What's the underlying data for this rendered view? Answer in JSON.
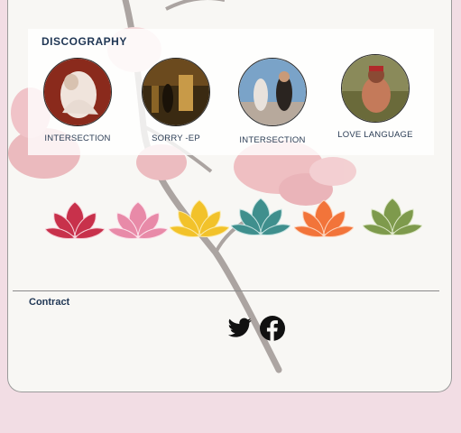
{
  "discography": {
    "title": "DISCOGRAPHY",
    "albums": [
      {
        "name": "INTERSECTION",
        "cover_icon": "album-cover-image"
      },
      {
        "name": "SORRY -EP",
        "cover_icon": "album-cover-image"
      },
      {
        "name": "INTERSECTION",
        "cover_icon": "album-cover-image"
      },
      {
        "name": "LOVE LANGUAGE",
        "cover_icon": "album-cover-image"
      }
    ]
  },
  "lotus_icons": [
    {
      "name": "lotus-icon",
      "color": "#c8314b"
    },
    {
      "name": "lotus-icon",
      "color": "#e88aa8"
    },
    {
      "name": "lotus-icon",
      "color": "#f2c22a"
    },
    {
      "name": "lotus-icon",
      "color": "#3f8f8d"
    },
    {
      "name": "lotus-icon",
      "color": "#f2743a"
    },
    {
      "name": "lotus-icon",
      "color": "#7e9a4c"
    }
  ],
  "footer": {
    "contract_label": "Contract",
    "social": [
      {
        "name": "twitter-icon"
      },
      {
        "name": "facebook-icon"
      }
    ]
  },
  "colors": {
    "page_background": "#f2dde4",
    "card_background": "#f8f7f4",
    "heading": "#1f3654"
  }
}
